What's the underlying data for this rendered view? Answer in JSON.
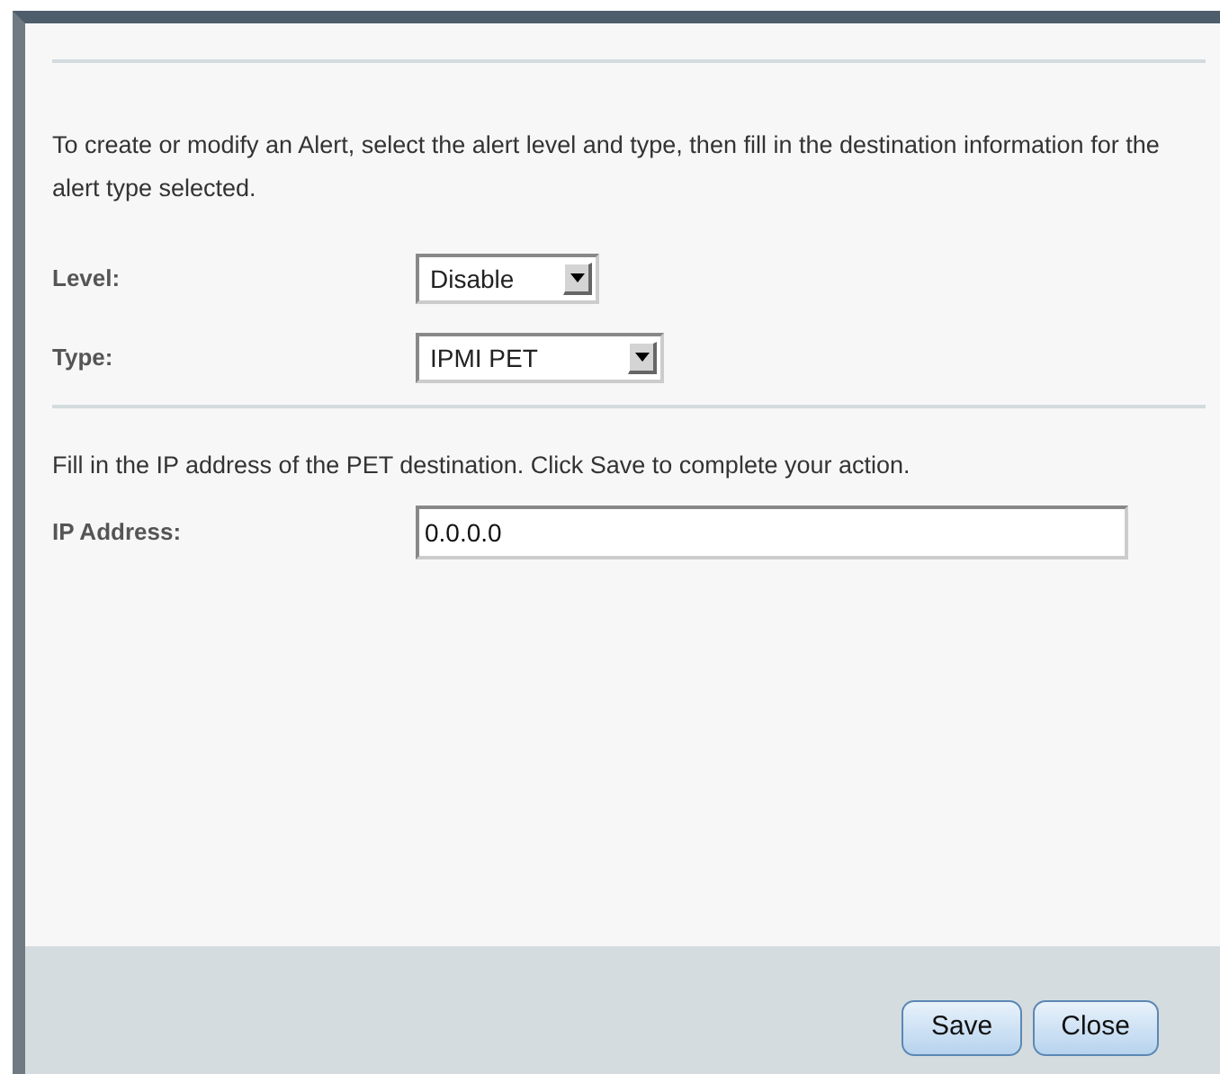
{
  "intro": "To create or modify an Alert, select the alert level and type, then fill in the destination information for the alert type selected.",
  "fields": [
    {
      "label": "Level:",
      "value": "Disable",
      "kind": "select"
    },
    {
      "label": "Type:",
      "value": "IPMI PET",
      "kind": "select"
    }
  ],
  "instructions": "Fill in the IP address of the PET destination. Click Save to complete your action.",
  "ip_field": {
    "label": "IP Address:",
    "value": "0.0.0.0"
  },
  "buttons": [
    "Save",
    "Close"
  ]
}
